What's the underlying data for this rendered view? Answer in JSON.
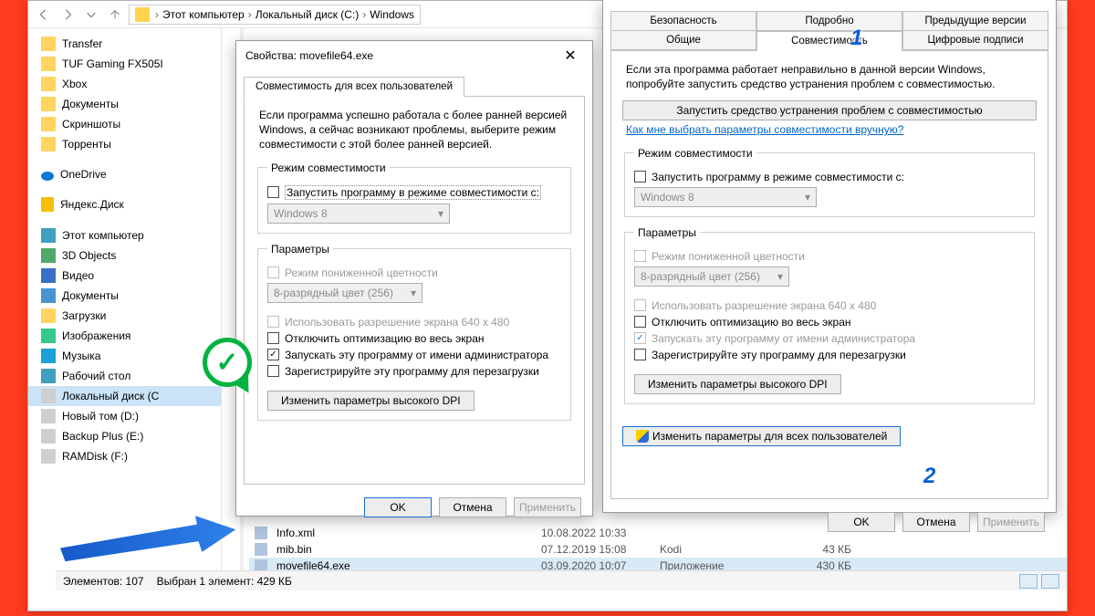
{
  "breadcrumb": {
    "pc": "Этот компьютер",
    "drive": "Локальный диск (C:)",
    "folder": "Windows"
  },
  "sidebar": {
    "items": [
      {
        "label": "Transfer",
        "icon": "folder"
      },
      {
        "label": "TUF Gaming FX505I",
        "icon": "folder"
      },
      {
        "label": "Xbox",
        "icon": "folder"
      },
      {
        "label": "Документы",
        "icon": "folder"
      },
      {
        "label": "Скриншоты",
        "icon": "folder"
      },
      {
        "label": "Торренты",
        "icon": "folder"
      },
      {
        "label": "OneDrive",
        "icon": "cloud",
        "gap": true
      },
      {
        "label": "Яндекс.Диск",
        "icon": "yadisk",
        "gap": true
      },
      {
        "label": "Этот компьютер",
        "icon": "pc",
        "gap": true
      },
      {
        "label": "3D Objects",
        "icon": "cube"
      },
      {
        "label": "Видео",
        "icon": "vid"
      },
      {
        "label": "Документы",
        "icon": "doc"
      },
      {
        "label": "Загрузки",
        "icon": "folder"
      },
      {
        "label": "Изображения",
        "icon": "img"
      },
      {
        "label": "Музыка",
        "icon": "music"
      },
      {
        "label": "Рабочий стол",
        "icon": "pc"
      },
      {
        "label": "Локальный диск (С",
        "icon": "drive",
        "selected": true
      },
      {
        "label": "Новый том (D:)",
        "icon": "drive"
      },
      {
        "label": "Backup Plus   (E:)",
        "icon": "drive"
      },
      {
        "label": "RAMDisk (F:)",
        "icon": "drive"
      }
    ]
  },
  "files": [
    {
      "name": "Info.xml",
      "date": "10.08.2022 10:33",
      "type": "",
      "size": ""
    },
    {
      "name": "mib.bin",
      "date": "07.12.2019 15:08",
      "type": "Kodi",
      "size": "43 КБ"
    },
    {
      "name": "movefile64.exe",
      "date": "03.09.2020 10:07",
      "type": "Приложение",
      "size": "430 КБ",
      "selected": true
    }
  ],
  "status": {
    "count": "Элементов: 107",
    "sel": "Выбран 1 элемент: 429 КБ"
  },
  "dialog1": {
    "title": "Свойства: movefile64.exe",
    "tab": "Совместимость для всех пользователей",
    "para": "Если программа успешно работала с более ранней версией Windows, а сейчас возникают проблемы, выберите режим совместимости с этой более ранней версией.",
    "group_mode": "Режим совместимости",
    "chk_mode": "Запустить программу в режиме совместимости с:",
    "sel_mode": "Windows 8",
    "group_params": "Параметры",
    "chk_color": "Режим пониженной цветности",
    "sel_color": "8-разрядный цвет (256)",
    "chk_res": "Использовать разрешение экрана 640 x 480",
    "chk_full": "Отключить оптимизацию во весь экран",
    "chk_admin": "Запускать эту программу от имени администратора",
    "chk_reboot": "Зарегистрируйте эту программу для перезагрузки",
    "btn_dpi": "Изменить параметры высокого DPI",
    "ok": "OK",
    "cancel": "Отмена",
    "apply": "Применить"
  },
  "dialog2": {
    "tabs_row1": [
      "Безопасность",
      "Подробно",
      "Предыдущие версии"
    ],
    "tabs_row2": [
      "Общие",
      "Совместимость",
      "Цифровые подписи"
    ],
    "para": "Если эта программа работает неправильно в данной версии Windows, попробуйте запустить средство устранения проблем с совместимостью.",
    "btn_trouble": "Запустить средство устранения проблем с совместимостью",
    "link": "Как мне выбрать параметры совместимости вручную?",
    "group_mode": "Режим совместимости",
    "chk_mode": "Запустить программу в режиме совместимости с:",
    "sel_mode": "Windows 8",
    "group_params": "Параметры",
    "chk_color": "Режим пониженной цветности",
    "sel_color": "8-разрядный цвет (256)",
    "chk_res": "Использовать разрешение экрана 640 x 480",
    "chk_full": "Отключить оптимизацию во весь экран",
    "chk_admin": "Запускать эту программу от имени администратора",
    "chk_reboot": "Зарегистрируйте эту программу для перезагрузки",
    "btn_dpi": "Изменить параметры высокого DPI",
    "btn_all": "Изменить параметры для всех пользователей",
    "ok": "OK",
    "cancel": "Отмена",
    "apply": "Применить"
  },
  "annot": {
    "one": "1",
    "two": "2"
  }
}
